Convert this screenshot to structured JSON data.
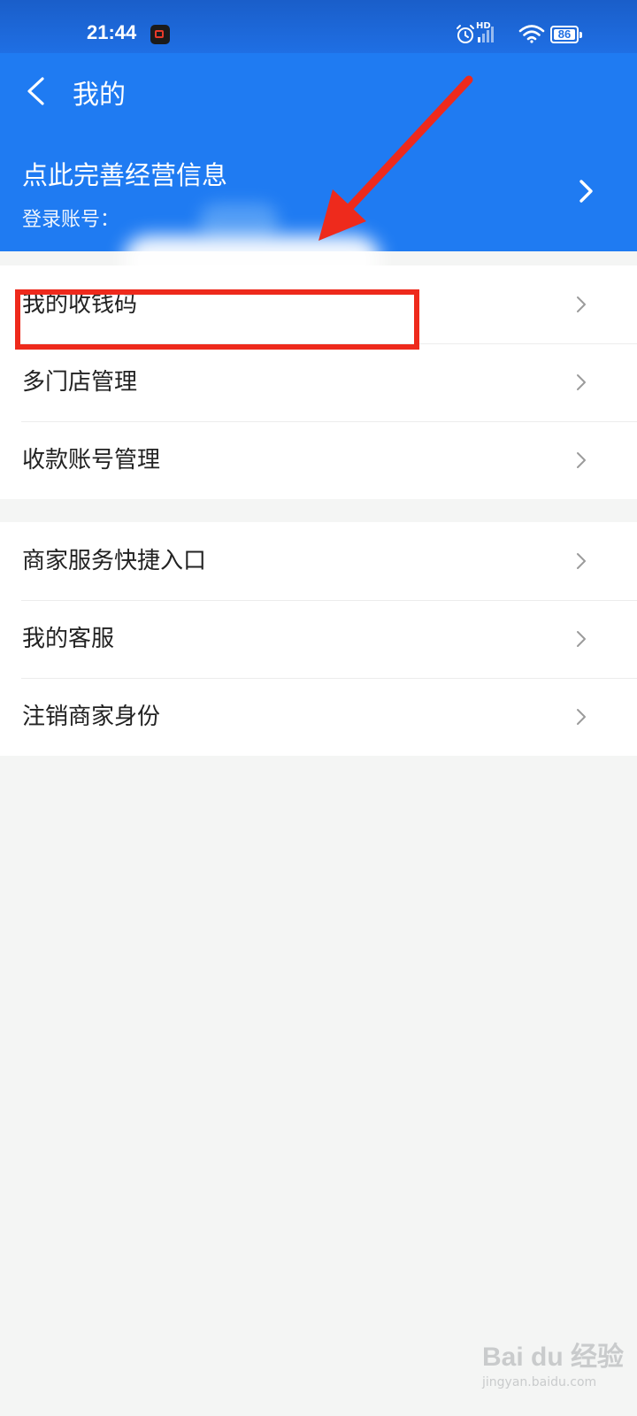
{
  "status_bar": {
    "time": "21:44",
    "network": "HD",
    "battery_percent": "86"
  },
  "header": {
    "title": "我的",
    "business_title": "点此完善经营信息",
    "account_label": "登录账号："
  },
  "menu_group_1": [
    {
      "label": "我的收钱码"
    },
    {
      "label": "多门店管理"
    },
    {
      "label": "收款账号管理"
    }
  ],
  "menu_group_2": [
    {
      "label": "商家服务快捷入口"
    },
    {
      "label": "我的客服"
    },
    {
      "label": "注销商家身份"
    }
  ],
  "annotation": {
    "highlight_color": "#ee2a1c",
    "arrow_color": "#ee2a1c"
  },
  "watermark": {
    "logo": "Bai du 经验",
    "subtitle": "jingyan.baidu.com"
  },
  "colors": {
    "header_bg": "#1f7bf2",
    "page_bg": "#f4f5f4"
  }
}
